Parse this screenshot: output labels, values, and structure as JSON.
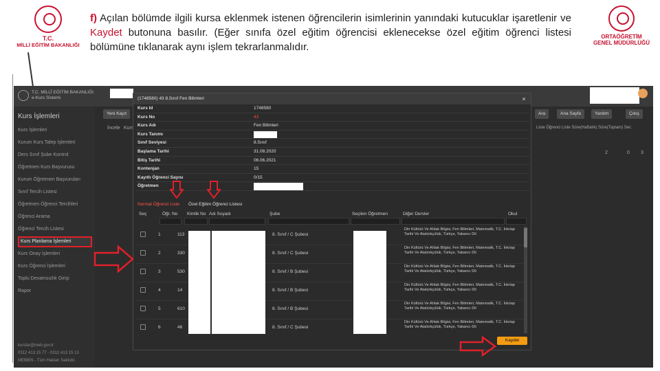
{
  "slide": {
    "left_logo": {
      "line1": "T.C.",
      "line2": "MİLLİ EĞİTİM BAKANLIĞI"
    },
    "right_logo": {
      "line1": "ORTAÖĞRETİM",
      "line2": "GENEL MÜDÜRLÜĞÜ"
    },
    "instruction": {
      "prefix": "f)",
      "part1": " Açılan bölümde ilgili kursa eklenmek istenen öğrencilerin isimlerinin yanındaki kutucuklar işaretlenir ve ",
      "keyword": "Kaydet",
      "part2": " butonuna basılır. (Eğer sınıfa özel eğitim öğrencisi eklenecekse özel eğitim öğrenci listesi bölümüne tıklanarak aynı işlem tekrarlanmalıdır."
    }
  },
  "app": {
    "brand_line1": "T.C. MİLLÎ EĞİTİM BAKANLIĞI",
    "brand_line2": "e-Kurs Sistemi",
    "sidebar": {
      "title": "Kurs İşlemleri",
      "items": [
        "Kurs İşlemleri",
        "Kurum Kurs Talep İşlemleri",
        "Ders Sınıf Şube Kontrol",
        "Öğretmen Kurs Başvurusu",
        "Kurum Öğretmen Başvuruları",
        "Sınıf Tercih Listesi",
        "Öğretmen Öğrenci Tercihleri",
        "Öğrenci Arama",
        "Öğrenci Tercih Listesi",
        "Kurs Planlama İşlemleri",
        "Kurs Onay İşlemleri",
        "Kurs Öğrenci İşlemleri",
        "Toplu Devamsızlık Girişi",
        "Rapor"
      ],
      "footer": [
        "kurslar@meb.gov.tr",
        "0312 413 15 77 - 0312 413 15 13",
        "MEBBİS - Tüm Hakları Saklıdır."
      ]
    },
    "toolbar": {
      "buttons": [
        "Yeni Kayıt",
        "Ara",
        "Ana Sayfa",
        "Yardım",
        "Çıkış"
      ]
    },
    "bg_header_cells": [
      "Liste",
      "Öğrenci Liste",
      "Süre(Haftalık)",
      "Süre(Toplam)",
      "Sec"
    ],
    "bg_row_cells": [
      "İncele",
      "Kurs",
      "2",
      "0",
      "3"
    ],
    "modal": {
      "title": "(1748580) 43 8.Sınıf Fen Bilimleri",
      "close": "×",
      "info": [
        {
          "label": "Kurs Id",
          "value": "1748580",
          "red": false
        },
        {
          "label": "Kurs No",
          "value": "43",
          "red": true
        },
        {
          "label": "Kurs Adı",
          "value": "Fen Bilimleri",
          "red": false
        },
        {
          "label": "Kurs Tanımı",
          "value": "",
          "red": false
        },
        {
          "label": "Sınıf Seviyesi",
          "value": "8.Sınıf",
          "red": false
        },
        {
          "label": "Başlama Tarihi",
          "value": "31.08.2020",
          "red": false
        },
        {
          "label": "Bitiş Tarihi",
          "value": "06.06.2021",
          "red": false
        },
        {
          "label": "Kontenjan",
          "value": "15",
          "red": false
        },
        {
          "label": "Kayıtlı Öğrenci Sayısı",
          "value": "0/15",
          "red": false
        },
        {
          "label": "Öğretmen",
          "value": "",
          "red": false
        }
      ],
      "tabs": [
        "Normal Öğrenci Liste",
        "Özel Eğitim Öğrenci Listesi"
      ],
      "columns": [
        "Seç",
        "Öğr. No",
        "Kimlik No",
        "Adı Soyadı",
        "Şube",
        "Seçilen Öğretmen",
        "Diğer Dersler",
        "Okul"
      ],
      "rows": [
        {
          "idx": "1",
          "no": "113",
          "sube": "8. Sınıf / C Şubesi",
          "subjects": "Din Kültürü Ve Ahlak Bilgisi, Fen Bilimleri, Matematik, T.C. İnkılap Tarihi Ve Atatürkçülük, Türkçe, Yabancı Dil"
        },
        {
          "idx": "2",
          "no": "330",
          "sube": "8. Sınıf / C Şubesi",
          "subjects": "Din Kültürü Ve Ahlak Bilgisi, Fen Bilimleri, Matematik, T.C. İnkılap Tarihi Ve Atatürkçülük, Türkçe, Yabancı Dil"
        },
        {
          "idx": "3",
          "no": "530",
          "sube": "8. Sınıf / B Şubesi",
          "subjects": "Din Kültürü Ve Ahlak Bilgisi, Fen Bilimleri, Matematik, T.C. İnkılap Tarihi Ve Atatürkçülük, Türkçe, Yabancı Dil"
        },
        {
          "idx": "4",
          "no": "14",
          "sube": "8. Sınıf / B Şubesi",
          "subjects": "Din Kültürü Ve Ahlak Bilgisi, Fen Bilimleri, Matematik, T.C. İnkılap Tarihi Ve Atatürkçülük, Türkçe, Yabancı Dil"
        },
        {
          "idx": "5",
          "no": "610",
          "sube": "8. Sınıf / B Şubesi",
          "subjects": "Din Kültürü Ve Ahlak Bilgisi, Fen Bilimleri, Matematik, T.C. İnkılap Tarihi Ve Atatürkçülük, Türkçe, Yabancı Dil"
        },
        {
          "idx": "6",
          "no": "46",
          "sube": "8. Sınıf / C Şubesi",
          "subjects": "Din Kültürü Ve Ahlak Bilgisi, Fen Bilimleri, Matematik, T.C. İnkılap Tarihi Ve Atatürkçülük, Türkçe, Yabancı Dil"
        }
      ],
      "save_label": "Kaydet"
    }
  },
  "colors": {
    "accent_red": "#c8102e",
    "save_orange": "#f39c12",
    "annotation_red": "#e0202a"
  }
}
